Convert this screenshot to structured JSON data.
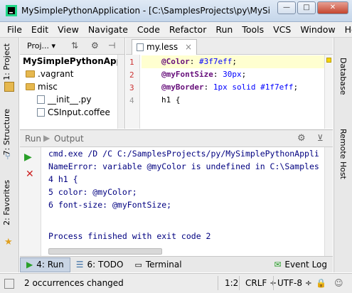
{
  "window": {
    "title": "MySimplePythonApplication - [C:\\SamplesProjects\\py\\MySimple..."
  },
  "menu": [
    "File",
    "Edit",
    "View",
    "Navigate",
    "Code",
    "Refactor",
    "Run",
    "Tools",
    "VCS",
    "Window",
    "Help"
  ],
  "left_strip": {
    "project_tab": "1: Project",
    "structure_tab": "7: Structure",
    "favorites_tab": "2: Favorites"
  },
  "right_strip": {
    "database_tab": "Database",
    "remote_host_tab": "Remote Host"
  },
  "project_panel": {
    "tab_label": "Proj...",
    "items": [
      {
        "label": "MySimplePythonApplica",
        "kind": "root"
      },
      {
        "label": ".vagrant",
        "kind": "folder"
      },
      {
        "label": "misc",
        "kind": "folder"
      },
      {
        "label": "__init__.py",
        "kind": "file"
      },
      {
        "label": "CSInput.coffee",
        "kind": "file"
      }
    ]
  },
  "editor": {
    "file_tab": "my.less",
    "lines": [
      {
        "num": "1",
        "var": "@Color",
        "rest": ": ",
        "value": "#3f7eff",
        "end": ";"
      },
      {
        "num": "2",
        "var": "@myFontSize",
        "rest": ": ",
        "value": "30px",
        "end": ";"
      },
      {
        "num": "3",
        "var": "@myBorder",
        "rest": ": ",
        "value": "1px solid #1f7eff",
        "end": ";"
      },
      {
        "num": "4",
        "var": "",
        "rest": "h1 {",
        "value": "",
        "end": ""
      }
    ]
  },
  "run_panel": {
    "tab_run": "Run",
    "tab_output": "Output",
    "console_lines": [
      "cmd.exe /D /C C:/SamplesProjects/py/MySimplePythonAppli",
      "NameError: variable @myColor is undefined in C:\\Samples",
      "4 h1 {",
      "5 color: @myColor;",
      "6 font-size: @myFontSize;",
      "Process finished with exit code 2"
    ]
  },
  "tool_windows": [
    {
      "label": "4: Run",
      "active": true
    },
    {
      "label": "6: TODO",
      "active": false
    },
    {
      "label": "Terminal",
      "active": false
    },
    {
      "label": "Event Log",
      "active": false
    }
  ],
  "status": {
    "message": "2 occurrences changed",
    "position": "1:2",
    "line_sep": "CRLF",
    "encoding": "UTF-8"
  },
  "colors": {
    "accent": "#3f7eff",
    "error": "#cc2222",
    "title_bar": "#c5d6ea"
  }
}
